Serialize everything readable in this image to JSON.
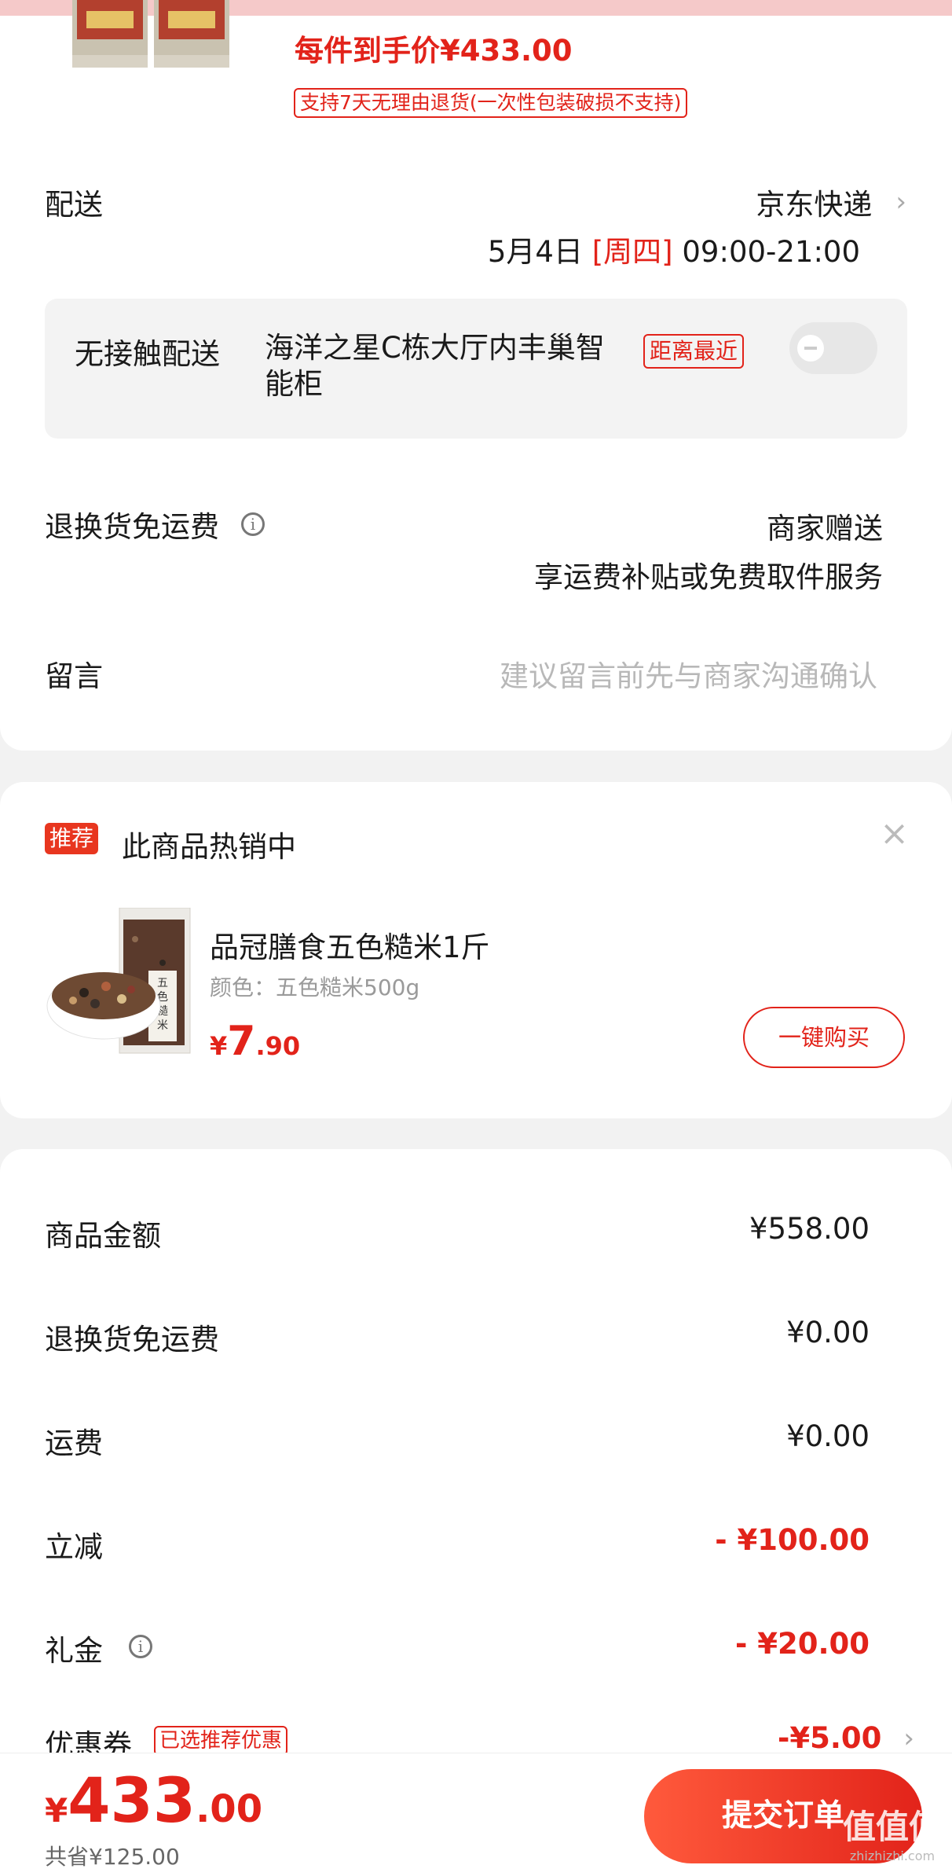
{
  "colors": {
    "accent": "#e2231a",
    "bg": "#f2f2f2",
    "card": "#ffffff",
    "muted": "#9a9a9a"
  },
  "product": {
    "final_price_label": "每件到手价¥433.00",
    "return_policy": "支持7天无理由退货(一次性包装破损不支持)"
  },
  "delivery": {
    "label": "配送",
    "carrier": "京东快递",
    "date": "5月4日",
    "weekday": "[周四]",
    "time": "09:00-21:00",
    "contactless_label": "无接触配送",
    "locker_name": "海洋之星C栋大厅内丰巢智能柜",
    "nearest_badge": "距离最近",
    "toggle_on": false
  },
  "return_shipping": {
    "label": "退换货免运费",
    "value_line1": "商家赠送",
    "value_line2": "享运费补贴或免费取件服务"
  },
  "note": {
    "label": "留言",
    "placeholder": "建议留言前先与商家沟通确认"
  },
  "recommend": {
    "badge": "推荐",
    "title": "此商品热销中",
    "product_name": "品冠膳食五色糙米1斤",
    "spec": "颜色：五色糙米500g",
    "price_symbol": "¥",
    "price_int": "7",
    "price_dec": ".90",
    "buy_button": "一键购买",
    "package_text": "五色糙米"
  },
  "summary": {
    "rows": [
      {
        "label": "商品金额",
        "value": "¥558.00",
        "red": false,
        "info": false
      },
      {
        "label": "退换货免运费",
        "value": "¥0.00",
        "red": false,
        "info": false
      },
      {
        "label": "运费",
        "value": "¥0.00",
        "red": false,
        "info": false
      },
      {
        "label": "立减",
        "value": "- ¥100.00",
        "red": true,
        "info": false
      },
      {
        "label": "礼金",
        "value": "- ¥20.00",
        "red": true,
        "info": true
      }
    ],
    "coupon_label": "优惠券",
    "coupon_badge": "已选推荐优惠",
    "coupon_value": "-¥5.00"
  },
  "bottom_bar": {
    "currency": "¥",
    "total_int": "433",
    "total_dec": ".00",
    "saved": "共省¥125.00",
    "submit": "提交订单"
  },
  "watermark": {
    "text": "值值值",
    "sub": "zhizhizhi.com"
  }
}
